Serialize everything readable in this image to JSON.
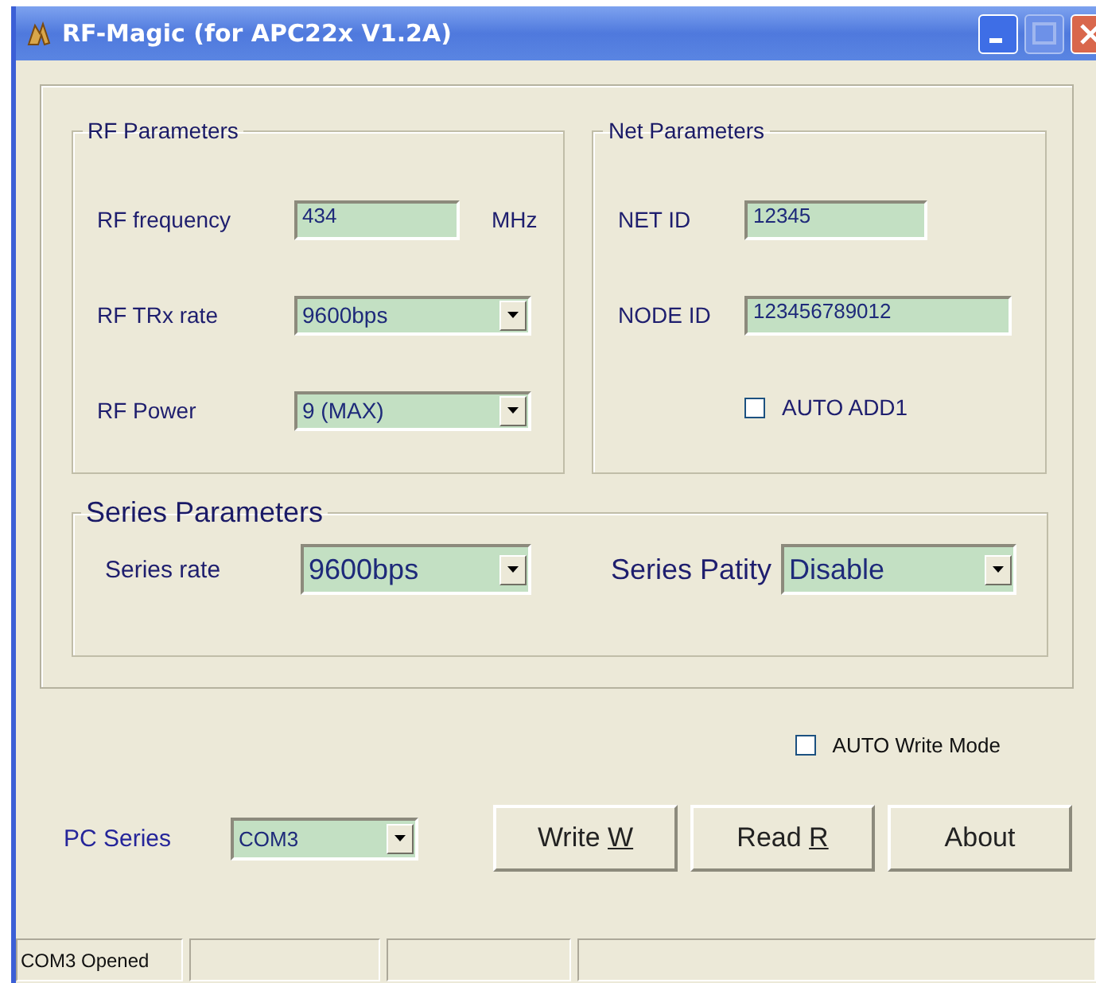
{
  "window": {
    "title": "RF-Magic (for APC22x V1.2A)",
    "maximize_disabled": true
  },
  "rf_parameters": {
    "title": "RF Parameters",
    "rows": [
      {
        "kind": "text",
        "label": "RF frequency",
        "value": "434",
        "unit": "MHz"
      },
      {
        "kind": "combo",
        "label": "RF TRx rate",
        "value": "9600bps"
      },
      {
        "kind": "combo",
        "label": "RF Power",
        "value": "9 (MAX)"
      }
    ]
  },
  "net_parameters": {
    "title": "Net Parameters",
    "rows": [
      {
        "kind": "text",
        "label": "NET ID",
        "value": "12345"
      },
      {
        "kind": "text",
        "label": "NODE ID",
        "value": "123456789012"
      }
    ],
    "auto_add": {
      "label": "AUTO ADD1",
      "checked": false
    }
  },
  "series_parameters": {
    "title": "Series Parameters",
    "rate": {
      "label": "Series rate",
      "value": "9600bps"
    },
    "parity": {
      "label": "Series Patity",
      "value": "Disable"
    }
  },
  "auto_write_mode": {
    "label": "AUTO Write Mode",
    "checked": false
  },
  "pc_series": {
    "label": "PC Series",
    "value": "COM3"
  },
  "buttons": [
    {
      "text": "Write ",
      "accel": "W"
    },
    {
      "text": "Read ",
      "accel": "R"
    },
    {
      "text": "About"
    }
  ],
  "status_bar": [
    "COM3 Opened"
  ]
}
